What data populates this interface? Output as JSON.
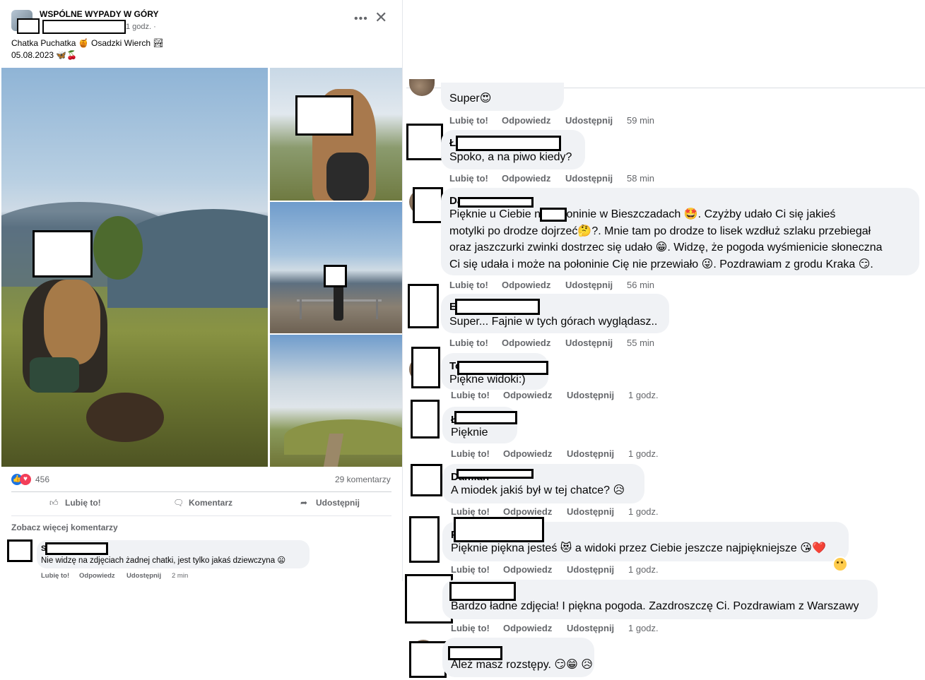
{
  "post": {
    "group_name": "WSPÓLNE WYPADY W GÓRY",
    "time": "1 godz. ·",
    "more_icon": "more-horizontal-icon",
    "close_icon": "close-icon",
    "text": "Chatka Puchatka 🍯 Osadzki Wierch 🏞\n05.08.2023 🦋🍒",
    "reaction_count": "456",
    "comment_count": "29 komentarzy",
    "actions": {
      "like": "Lubię to!",
      "comment": "Komentarz",
      "share": "Udostępnij"
    },
    "see_more_comments": "Zobacz więcej komentarzy",
    "visible_comment": {
      "author": "St",
      "text": "Nie widzę na zdjęciach żadnej chatki, jest tylko jakaś dziewczyna 😦",
      "like": "Lubię to!",
      "reply": "Odpowiedz",
      "share": "Udostępnij",
      "time": "2 min"
    }
  },
  "comments": [
    {
      "author": "",
      "text": "Super😍",
      "time": "59 min"
    },
    {
      "author": "Ł",
      "text": "Spoko, a na piwo kiedy?",
      "time": "58 min"
    },
    {
      "author": "Da",
      "text": "Pięknie u Ciebie       na Połoninie w Bieszczadach 🤩. Czyżby udało Ci się jakieś\nmotylki po drodze dojrzeć🤔?. Mnie tam po drodze to lisek wzdłuż szlaku przebiegał\noraz jaszczurki zwinki dostrzec się udało 😁. Widzę, że pogoda wyśmienicie słoneczna\nCi się udała i może na połoninie Cię nie przewiało 😜. Pozdrawiam z grodu Kraka 😏.",
      "time": "56 min"
    },
    {
      "author": "E",
      "text": "Super... Fajnie w tych górach wyglądasz..",
      "time": "55 min"
    },
    {
      "author": "To",
      "text": "Piękne widoki:)",
      "time": "1 godz."
    },
    {
      "author": "Ł",
      "text": "Pięknie",
      "time": "1 godz."
    },
    {
      "author": "Damian",
      "text": "A miodek jakiś był w tej chatce? 😥",
      "time": "1 godz."
    },
    {
      "author": "P",
      "text": "Pięknie piękna jesteś 😻 a widoki przez Ciebie jeszcze najpiękniejsze 😘❤️",
      "time": "1 godz."
    },
    {
      "author": "",
      "text": "Bardzo ładne zdjęcia! I piękna pogoda. Zazdroszczę Ci. Pozdrawiam z Warszawy",
      "time": "1 godz."
    },
    {
      "author": "",
      "text": "Ależ masz rozstępy. 😏😁 😥",
      "time": ""
    }
  ],
  "comment_actions": {
    "like": "Lubię to!",
    "reply": "Odpowiedz",
    "share": "Udostępnij"
  },
  "colors": {
    "accent": "#1b74e4",
    "love": "#f33e58",
    "meta_text": "#65676b",
    "bubble": "#f0f2f5"
  }
}
